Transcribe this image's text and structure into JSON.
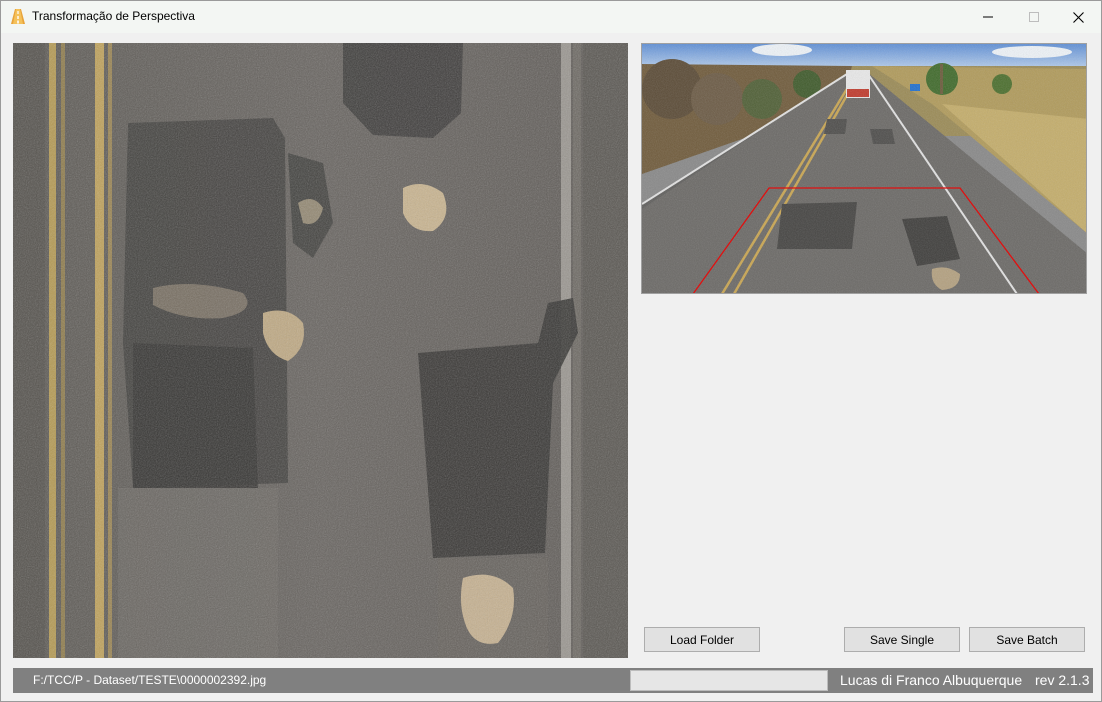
{
  "window": {
    "title": "Transformação de Perspectiva",
    "app_icon": "road-app-icon",
    "controls": [
      "minimize-icon",
      "maximize-icon",
      "close-icon"
    ]
  },
  "buttons": {
    "load_folder": "Load Folder",
    "save_single": "Save Single",
    "save_batch": "Save Batch"
  },
  "status": {
    "path": "F:/TCC/P - Dataset/TESTE\\0000002392.jpg",
    "progress": 0,
    "author": "Lucas di Franco Albuquerque",
    "revision": "rev 2.1.3"
  },
  "colors": {
    "roi_outline": "#e01010",
    "statusbar": "#808080",
    "progress_fill": "#06b025"
  }
}
